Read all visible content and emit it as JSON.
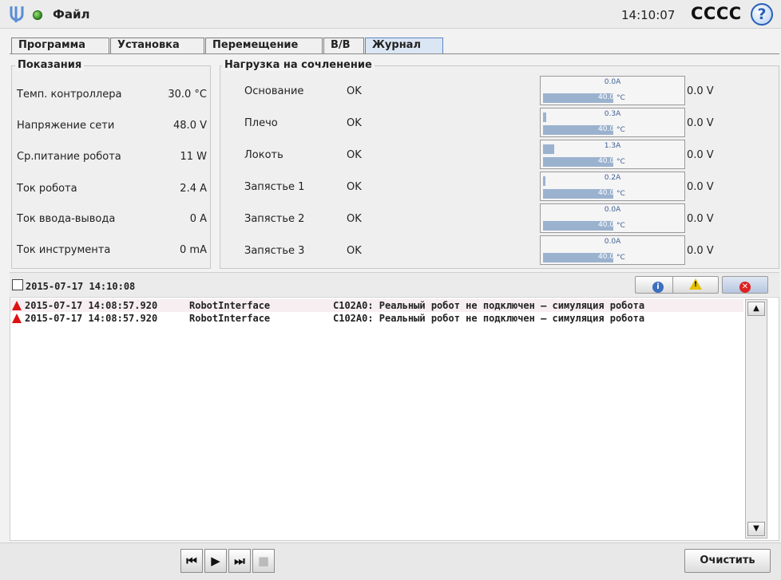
{
  "titlebar": {
    "file_menu": "Файл",
    "clock": "14:10:07",
    "robot_name": "CCCC",
    "help_label": "?",
    "logo_icon": "ur-logo-icon",
    "status_color": "#3a9b2a"
  },
  "tabs": [
    {
      "label": "Программа",
      "active": false
    },
    {
      "label": "Установка",
      "active": false
    },
    {
      "label": "Перемещение",
      "active": false
    },
    {
      "label": "В/В",
      "active": false
    },
    {
      "label": "Журнал",
      "active": true
    }
  ],
  "readings": {
    "title": "Показания",
    "items": [
      {
        "label": "Темп. контроллера",
        "value": "30.0 °C"
      },
      {
        "label": "Напряжение сети",
        "value": "48.0  V"
      },
      {
        "label": "Ср.питание робота",
        "value": "11  W"
      },
      {
        "label": "Ток робота",
        "value": "2.4  A"
      },
      {
        "label": "Ток ввода-вывода",
        "value": "0  A"
      },
      {
        "label": "Ток инструмента",
        "value": "0 mA"
      }
    ]
  },
  "joints": {
    "title": "Нагрузка на сочленение",
    "items": [
      {
        "name": "Основание",
        "status": "OK",
        "current": "0.0A",
        "current_fraction": 0.0,
        "temp": "40.0",
        "temp_unit": "°C",
        "voltage": "0.0 V"
      },
      {
        "name": "Плечо",
        "status": "OK",
        "current": "0.3A",
        "current_fraction": 0.02,
        "temp": "40.0",
        "temp_unit": "°C",
        "voltage": "0.0 V"
      },
      {
        "name": "Локоть",
        "status": "OK",
        "current": "1.3A",
        "current_fraction": 0.08,
        "temp": "40.0",
        "temp_unit": "°C",
        "voltage": "0.0 V"
      },
      {
        "name": "Запястье 1",
        "status": "OK",
        "current": "0.2A",
        "current_fraction": 0.01,
        "temp": "40.0",
        "temp_unit": "°C",
        "voltage": "0.0 V"
      },
      {
        "name": "Запястье 2",
        "status": "OK",
        "current": "0.0A",
        "current_fraction": 0.0,
        "temp": "40.0",
        "temp_unit": "°C",
        "voltage": "0.0 V"
      },
      {
        "name": "Запястье 3",
        "status": "OK",
        "current": "0.0A",
        "current_fraction": 0.0,
        "temp": "40.0",
        "temp_unit": "°C",
        "voltage": "0.0 V"
      }
    ]
  },
  "log": {
    "header_date": "2015-07-17 14:10:08",
    "filters": [
      {
        "name": "info-filter-button",
        "icon": "info-icon",
        "symbol": "i",
        "on": false
      },
      {
        "name": "warning-filter-button",
        "icon": "warning-icon",
        "symbol": "!",
        "on": false
      },
      {
        "name": "error-filter-button",
        "icon": "error-icon",
        "symbol": "✕",
        "on": true
      }
    ],
    "entries": [
      {
        "level": "warning",
        "time": "2015-07-17 14:08:57.920",
        "source": "RobotInterface",
        "message": "C102A0: Реальный робот не подключен – симуляция робота"
      },
      {
        "level": "warning",
        "time": "2015-07-17 14:08:57.920",
        "source": "RobotInterface",
        "message": "C102A0: Реальный робот не подключен – симуляция робота"
      }
    ]
  },
  "bottom": {
    "controls": [
      {
        "name": "rewind-button",
        "icon": "rewind-icon",
        "glyph": "⏮"
      },
      {
        "name": "play-button",
        "icon": "play-icon",
        "glyph": "▶"
      },
      {
        "name": "step-button",
        "icon": "step-icon",
        "glyph": "⏭"
      },
      {
        "name": "stop-button",
        "icon": "stop-icon",
        "glyph": "■",
        "disabled": true
      }
    ],
    "clear_label": "Очистить"
  }
}
